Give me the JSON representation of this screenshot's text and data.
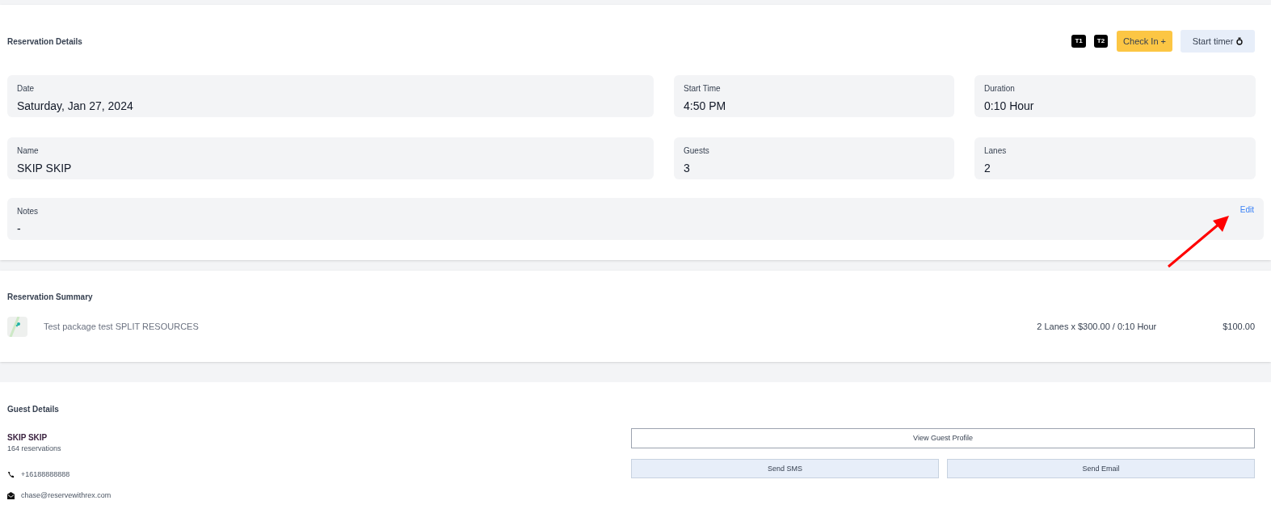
{
  "details": {
    "title": "Reservation Details",
    "tags": [
      "T1",
      "T2"
    ],
    "check_in": "Check In +",
    "start_timer": "Start timer",
    "fields": [
      {
        "label": "Date",
        "value": "Saturday, Jan 27, 2024"
      },
      {
        "label": "Start Time",
        "value": "4:50 PM"
      },
      {
        "label": "Duration",
        "value": "0:10 Hour"
      },
      {
        "label": "Name",
        "value": "SKIP SKIP"
      },
      {
        "label": "Guests",
        "value": "3"
      },
      {
        "label": "Lanes",
        "value": "2"
      }
    ],
    "notes": {
      "label": "Notes",
      "value": "-",
      "edit": "Edit"
    }
  },
  "summary": {
    "title": "Reservation Summary",
    "items": [
      {
        "name": "Test package test SPLIT RESOURCES",
        "detail": "2 Lanes x $300.00 / 0:10 Hour",
        "price": "$100.00"
      }
    ]
  },
  "guest": {
    "title": "Guest Details",
    "name": "SKIP SKIP",
    "reservations": "164 reservations",
    "phone": "+16188888888",
    "email": "chase@reservewithrex.com",
    "view_profile": "View Guest Profile",
    "send_sms": "Send SMS",
    "send_email": "Send Email"
  }
}
